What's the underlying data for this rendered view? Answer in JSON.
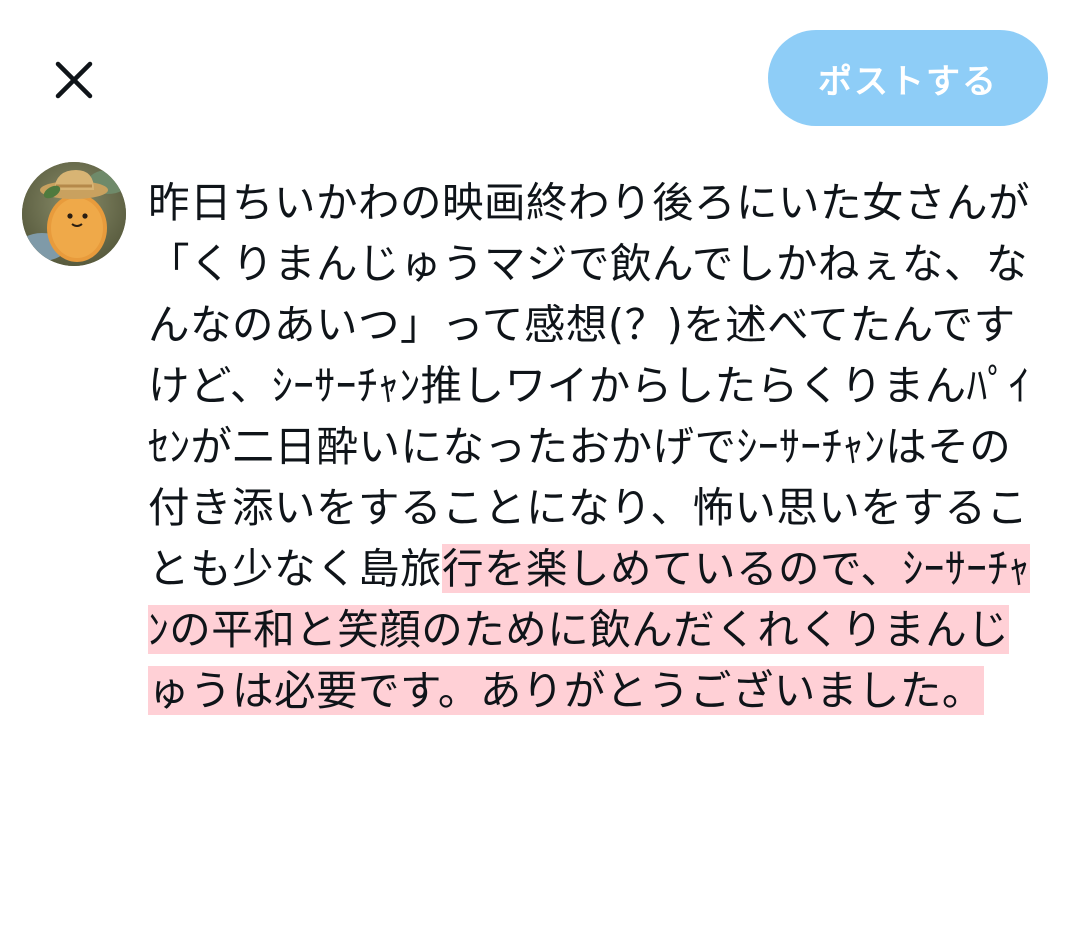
{
  "toolbar": {
    "close_icon": "close-icon",
    "post_label": "ポストする",
    "post_color": "#8ecdf7"
  },
  "avatar": {
    "icon": "avatar-nugget-character"
  },
  "compose": {
    "text_plain": "昨日ちいかわの映画終わり後ろにいた女さんが「くりまんじゅうマジで飲んでしかねぇな、なんなのあいつ」って感想(？)を述べてたんですけど、ｼｰｻｰﾁｬﾝ推しワイからしたらくりまんﾊﾟｲｾﾝが二日酔いになったおかげでｼｰｻｰﾁｬﾝはその付き添いをすることになり、怖い思いをすることも少なく島旅",
    "text_highlighted": "行を楽しめているので、ｼｰｻｰﾁｬﾝの平和と笑顔のために飲んだくれくりまんじゅうは必要です。ありがとうございました。",
    "highlight_color": "#ffd0d6"
  }
}
